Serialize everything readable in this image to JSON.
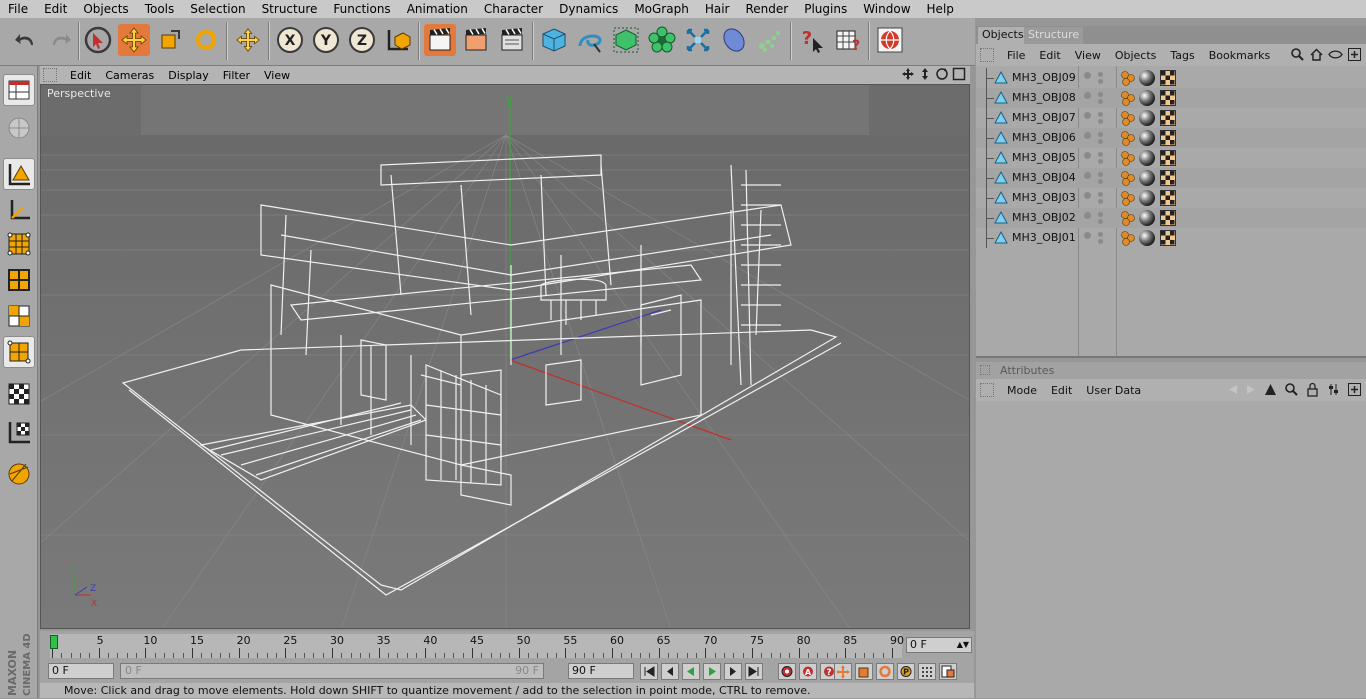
{
  "menubar": {
    "items": [
      "File",
      "Edit",
      "Objects",
      "Tools",
      "Selection",
      "Structure",
      "Functions",
      "Animation",
      "Character",
      "Dynamics",
      "MoGraph",
      "Hair",
      "Render",
      "Plugins",
      "Window",
      "Help"
    ]
  },
  "viewport": {
    "menu": [
      "Edit",
      "Cameras",
      "Display",
      "Filter",
      "View"
    ],
    "camera_label": "Perspective"
  },
  "timeline": {
    "ticks": [
      "0",
      "5",
      "10",
      "15",
      "20",
      "25",
      "30",
      "35",
      "40",
      "45",
      "50",
      "55",
      "60",
      "65",
      "70",
      "75",
      "80",
      "85",
      "90"
    ],
    "current_frame": "0 F",
    "start_field": "0 F",
    "range_start": "0 F",
    "range_end": "90 F",
    "end_field": "90 F"
  },
  "status": "Move: Click and drag to move elements. Hold down SHIFT to quantize movement / add to the selection in point mode, CTRL to remove.",
  "brand": "MAXON CINEMA 4D",
  "object_manager": {
    "tabs": [
      "Objects",
      "Structure"
    ],
    "menu": [
      "File",
      "Edit",
      "View",
      "Objects",
      "Tags",
      "Bookmarks"
    ],
    "objects": [
      "MH3_OBJ09",
      "MH3_OBJ08",
      "MH3_OBJ07",
      "MH3_OBJ06",
      "MH3_OBJ05",
      "MH3_OBJ04",
      "MH3_OBJ03",
      "MH3_OBJ02",
      "MH3_OBJ01"
    ]
  },
  "attributes": {
    "title": "Attributes",
    "menu": [
      "Mode",
      "Edit",
      "User Data"
    ]
  },
  "colors": {
    "accent": "#e37a3b",
    "viewport_bg": "#727272",
    "panel_bg": "#a9a9a9",
    "axis_x": "#c0302c",
    "axis_y": "#3aa53a",
    "axis_z": "#3b3bb5"
  }
}
